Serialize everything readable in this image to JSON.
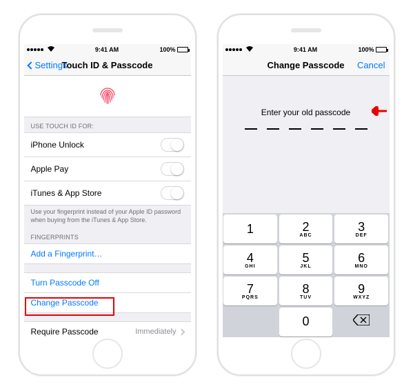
{
  "status": {
    "time": "9:41 AM",
    "battery_pct": "100%"
  },
  "phone1": {
    "nav": {
      "back": "Settings",
      "title": "Touch ID & Passcode"
    },
    "sections": {
      "use_for_header": "USE TOUCH ID FOR:",
      "use_for_items": [
        {
          "label": "iPhone Unlock"
        },
        {
          "label": "Apple Pay"
        },
        {
          "label": "iTunes & App Store"
        }
      ],
      "use_for_footer": "Use your fingerprint instead of your Apple ID password when buying from the iTunes & App Store.",
      "fingerprints_header": "FINGERPRINTS",
      "add_fingerprint": "Add a Fingerprint…",
      "turn_off": "Turn Passcode Off",
      "change_passcode": "Change Passcode",
      "require": {
        "label": "Require Passcode",
        "value": "Immediately"
      }
    }
  },
  "phone2": {
    "nav": {
      "title": "Change Passcode",
      "cancel": "Cancel"
    },
    "prompt": "Enter your old passcode",
    "keypad": [
      [
        {
          "n": "1",
          "l": ""
        },
        {
          "n": "2",
          "l": "ABC"
        },
        {
          "n": "3",
          "l": "DEF"
        }
      ],
      [
        {
          "n": "4",
          "l": "GHI"
        },
        {
          "n": "5",
          "l": "JKL"
        },
        {
          "n": "6",
          "l": "MNO"
        }
      ],
      [
        {
          "n": "7",
          "l": "PQRS"
        },
        {
          "n": "8",
          "l": "TUV"
        },
        {
          "n": "9",
          "l": "WXYZ"
        }
      ],
      [
        {
          "blank": true
        },
        {
          "n": "0",
          "l": ""
        },
        {
          "backspace": true
        }
      ]
    ]
  }
}
